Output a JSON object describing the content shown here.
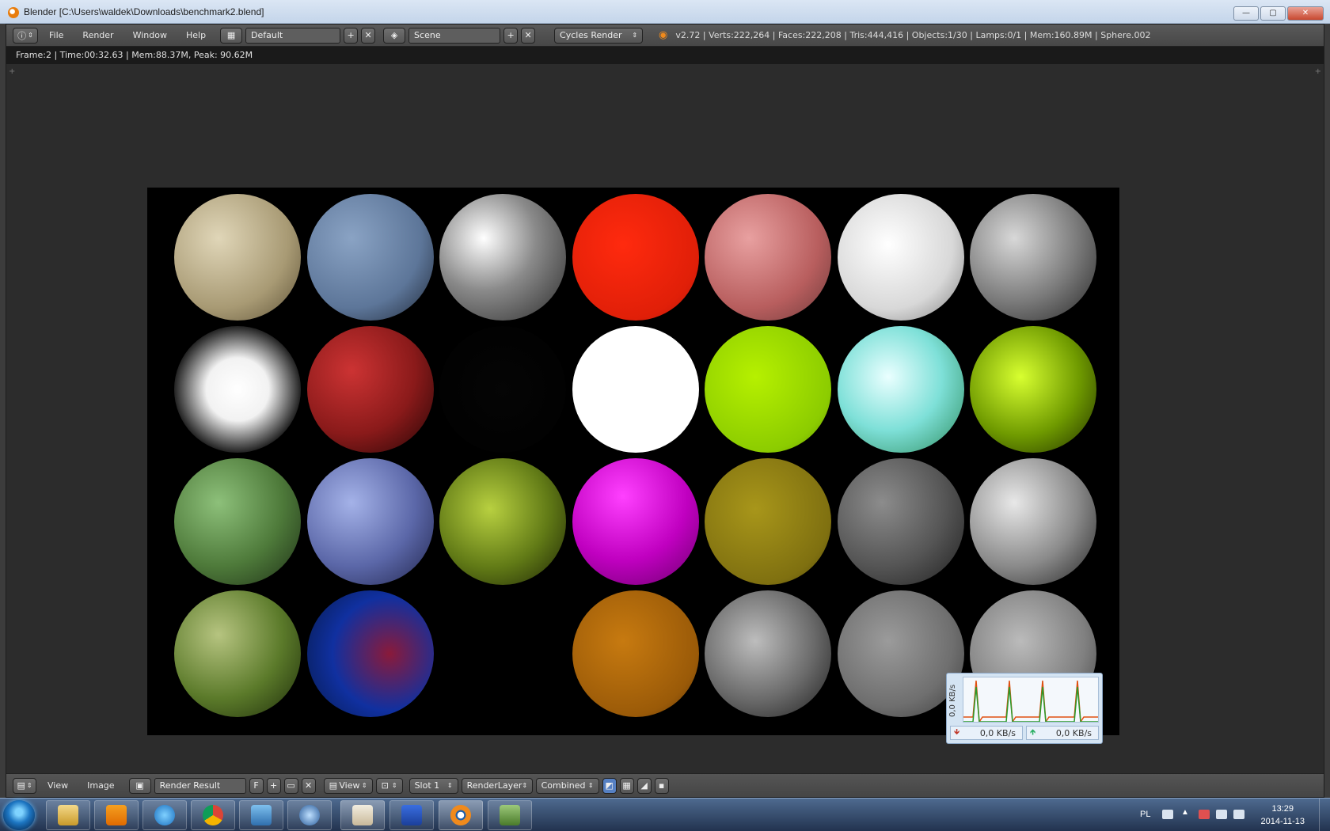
{
  "window": {
    "title": "Blender [C:\\Users\\waldek\\Downloads\\benchmark2.blend]",
    "min_label": "—",
    "max_label": "▢",
    "close_label": "✕"
  },
  "info_header": {
    "editor_icon": "ⓘ",
    "menus": [
      "File",
      "Render",
      "Window",
      "Help"
    ],
    "screen_layout": "Default",
    "scene": "Scene",
    "render_engine": "Cycles Render",
    "stats": "v2.72 | Verts:222,264 | Faces:222,208 | Tris:444,416 | Objects:1/30 | Lamps:0/1 | Mem:160.89M | Sphere.002"
  },
  "render_status": "Frame:2 | Time:00:32.63 | Mem:88.37M, Peak: 90.62M",
  "spheres": [
    {
      "fill": "radial-gradient(circle at 35% 35%, #e0d6b8, #a89a74 60%, #5b4f35)"
    },
    {
      "fill": "radial-gradient(circle at 35% 35%, #8aa3c4, #5d7699 60%, #1d2533)"
    },
    {
      "fill": "radial-gradient(circle at 35% 35%, #ffffff, #8a8a8a 45%, #2a2a2a)"
    },
    {
      "fill": "radial-gradient(circle at 40% 40%, #ff2a0e, #e01f08 70%, #b01404)"
    },
    {
      "fill": "radial-gradient(circle at 35% 35%, #e8a0a0, #b85e5e 60%, #6b3a3a)"
    },
    {
      "fill": "radial-gradient(circle at 40% 40%, #ffffff, #d8d8d8 60%, #7a7a7a)"
    },
    {
      "fill": "radial-gradient(circle at 35% 35%, #d8d8d8, #7a7a7a 55%, #252525)"
    },
    {
      "fill": "radial-gradient(circle at 50% 50%, #ffffff, #f2f2f2 35%, rgba(255,255,255,0.15) 70%, rgba(0,0,0,0))"
    },
    {
      "fill": "radial-gradient(circle at 35% 35%, #cc3333, #8a1a1a 55%, #210505)"
    },
    {
      "fill": "radial-gradient(circle at 50% 50%, #050505, #000000)"
    },
    {
      "fill": "radial-gradient(circle at 50% 50%, #ffffff, #ffffff)"
    },
    {
      "fill": "radial-gradient(circle at 40% 40%, #b6f000, #8ccc00 70%, #5c8f00)"
    },
    {
      "fill": "radial-gradient(circle at 40% 40%, #eaffff, #7ee0d8 50%, #2b8a5a)"
    },
    {
      "fill": "radial-gradient(circle at 40% 40%, #d8ff30, #6f9a00 55%, #1d2a00)"
    },
    {
      "fill": "radial-gradient(circle at 35% 35%, #8dc07a, #4e7a3a 55%, #1d2e16)"
    },
    {
      "fill": "radial-gradient(circle at 35% 35%, #a4b2e8, #5b67a8 55%, #1f234a)"
    },
    {
      "fill": "radial-gradient(circle at 40% 40%, #b8d040, #617a16 55%, #1a2005)"
    },
    {
      "fill": "radial-gradient(circle at 40% 30%, #ff40ff, #c000c0 55%, #6a006a)"
    },
    {
      "fill": "radial-gradient(circle at 40% 40%, #a8961a, #7f7010 70%, #4f4508)"
    },
    {
      "fill": "radial-gradient(circle at 35% 35%, #8c8c8c, #555 55%, #1e1e1e)"
    },
    {
      "fill": "radial-gradient(circle at 35% 35%, #e8e8e8, #8a8a8a 55%, #222)"
    },
    {
      "fill": "radial-gradient(circle at 35% 35%, #b6c480, #5b7a2a 55%, #1c2a0a)"
    },
    {
      "fill": "radial-gradient(circle at 65% 50%, #8a1a3a, #1030a0 55%, #061a4a)"
    },
    {
      "fill": "radial-gradient(circle at 50% 50%, #000 0 80%, #8ee000 84% 96%, #000 100%)"
    },
    {
      "fill": "radial-gradient(circle at 40% 40%, #c77a10, #9a5a08 70%, #5a3404)"
    },
    {
      "fill": "radial-gradient(circle at 40% 40%, #bdbdbd, #6a6a6a 55%, #1b1b1b)"
    },
    {
      "fill": "radial-gradient(circle at 40% 40%, #9b9b9b, #6f6f6f 60%, #3a3a3a)"
    },
    {
      "fill": "radial-gradient(circle at 40% 40%, #bbbbbb, #808080 60%, #3c3c3c)"
    }
  ],
  "net_meter": {
    "y_label": "0,0 KB/s",
    "download": "0,0 KB/s",
    "upload": "0,0 KB/s",
    "download_arrow": "🡻",
    "upload_arrow": "🡹"
  },
  "image_header": {
    "menus": [
      "View",
      "Image"
    ],
    "image_name": "Render Result",
    "fake_user": "F",
    "view_mode": "View",
    "slot": "Slot 1",
    "layer": "RenderLayer",
    "pass": "Combined"
  },
  "taskbar": {
    "language": "PL",
    "time": "13:29",
    "date": "2014-11-13"
  }
}
